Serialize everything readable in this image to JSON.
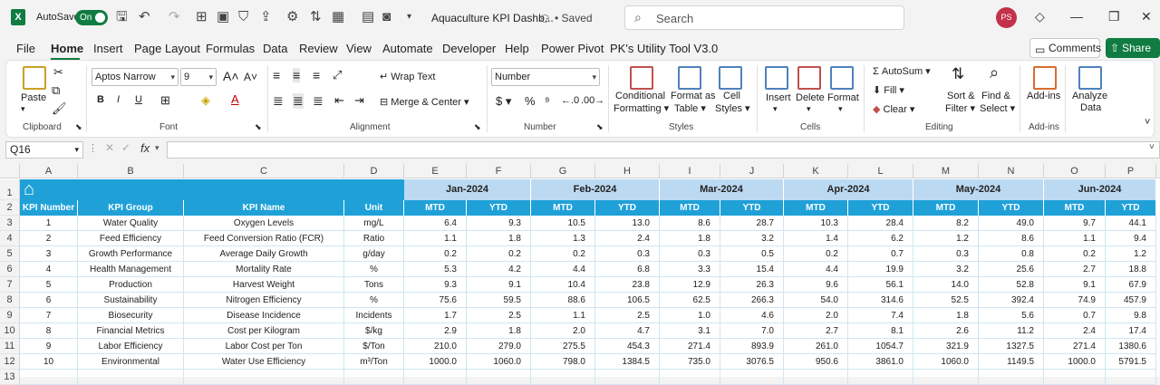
{
  "titlebar": {
    "autosave_label": "AutoSave",
    "autosave_state": "On",
    "doc_title": "Aquaculture KPI Dashb...",
    "saved_status": "• Saved",
    "search_placeholder": "Search",
    "user_initials": "PS"
  },
  "menu": {
    "items": [
      "File",
      "Home",
      "Insert",
      "Page Layout",
      "Formulas",
      "Data",
      "Review",
      "View",
      "Automate",
      "Developer",
      "Help",
      "Power Pivot",
      "PK's Utility Tool V3.0"
    ],
    "active": "Home",
    "comments_label": "Comments",
    "share_label": "Share"
  },
  "ribbon": {
    "clipboard": {
      "paste": "Paste",
      "label": "Clipboard"
    },
    "font": {
      "name": "Aptos Narrow",
      "size": "9",
      "label": "Font"
    },
    "alignment": {
      "wrap": "Wrap Text",
      "merge": "Merge & Center",
      "label": "Alignment"
    },
    "number": {
      "format": "Number",
      "label": "Number"
    },
    "styles": {
      "cond1": "Conditional",
      "cond2": "Formatting",
      "fmt1": "Format as",
      "fmt2": "Table",
      "cell1": "Cell",
      "cell2": "Styles",
      "label": "Styles"
    },
    "cells": {
      "insert": "Insert",
      "delete": "Delete",
      "format": "Format",
      "label": "Cells"
    },
    "editing": {
      "autosum": "AutoSum",
      "fill": "Fill",
      "clear": "Clear",
      "sort1": "Sort &",
      "sort2": "Filter",
      "find1": "Find &",
      "find2": "Select",
      "label": "Editing"
    },
    "addins": {
      "btn": "Add-ins",
      "label": "Add-ins"
    },
    "analyze": {
      "l1": "Analyze",
      "l2": "Data"
    }
  },
  "formula_bar": {
    "cell_ref": "Q16",
    "fx": "fx",
    "value": ""
  },
  "sheet": {
    "columns": [
      "A",
      "B",
      "C",
      "D",
      "E",
      "F",
      "G",
      "H",
      "I",
      "J",
      "K",
      "L",
      "M",
      "N",
      "O",
      "P"
    ],
    "rows": [
      "1",
      "2",
      "3",
      "4",
      "5",
      "6",
      "7",
      "8",
      "9",
      "10",
      "11",
      "12",
      "13"
    ],
    "months": [
      "Jan-2024",
      "Feb-2024",
      "Mar-2024",
      "Apr-2024",
      "May-2024",
      "Jun-2024"
    ],
    "headers": [
      "KPI Number",
      "KPI Group",
      "KPI Name",
      "Unit"
    ],
    "sub_headers": [
      "MTD",
      "YTD"
    ],
    "data": [
      [
        "1",
        "Water Quality",
        "Oxygen Levels",
        "mg/L",
        "6.4",
        "9.3",
        "10.5",
        "13.0",
        "8.6",
        "28.7",
        "10.3",
        "28.4",
        "8.2",
        "49.0",
        "9.7",
        "44.1"
      ],
      [
        "2",
        "Feed Efficiency",
        "Feed Conversion Ratio (FCR)",
        "Ratio",
        "1.1",
        "1.8",
        "1.3",
        "2.4",
        "1.8",
        "3.2",
        "1.4",
        "6.2",
        "1.2",
        "8.6",
        "1.1",
        "9.4"
      ],
      [
        "3",
        "Growth Performance",
        "Average Daily Growth",
        "g/day",
        "0.2",
        "0.2",
        "0.2",
        "0.3",
        "0.3",
        "0.5",
        "0.2",
        "0.7",
        "0.3",
        "0.8",
        "0.2",
        "1.2"
      ],
      [
        "4",
        "Health Management",
        "Mortality Rate",
        "%",
        "5.3",
        "4.2",
        "4.4",
        "6.8",
        "3.3",
        "15.4",
        "4.4",
        "19.9",
        "3.2",
        "25.6",
        "2.7",
        "18.8"
      ],
      [
        "5",
        "Production",
        "Harvest Weight",
        "Tons",
        "9.3",
        "9.1",
        "10.4",
        "23.8",
        "12.9",
        "26.3",
        "9.6",
        "56.1",
        "14.0",
        "52.8",
        "9.1",
        "67.9"
      ],
      [
        "6",
        "Sustainability",
        "Nitrogen Efficiency",
        "%",
        "75.6",
        "59.5",
        "88.6",
        "106.5",
        "62.5",
        "266.3",
        "54.0",
        "314.6",
        "52.5",
        "392.4",
        "74.9",
        "457.9"
      ],
      [
        "7",
        "Biosecurity",
        "Disease Incidence",
        "Incidents",
        "1.7",
        "2.5",
        "1.1",
        "2.5",
        "1.0",
        "4.6",
        "2.0",
        "7.4",
        "1.8",
        "5.6",
        "0.7",
        "9.8"
      ],
      [
        "8",
        "Financial Metrics",
        "Cost per Kilogram",
        "$/kg",
        "2.9",
        "1.8",
        "2.0",
        "4.7",
        "3.1",
        "7.0",
        "2.7",
        "8.1",
        "2.6",
        "11.2",
        "2.4",
        "17.4"
      ],
      [
        "9",
        "Labor Efficiency",
        "Labor Cost per Ton",
        "$/Ton",
        "210.0",
        "279.0",
        "275.5",
        "454.3",
        "271.4",
        "893.9",
        "261.0",
        "1054.7",
        "321.9",
        "1327.5",
        "271.4",
        "1380.6"
      ],
      [
        "10",
        "Environmental",
        "Water Use Efficiency",
        "m³/Ton",
        "1000.0",
        "1060.0",
        "798.0",
        "1384.5",
        "735.0",
        "3076.5",
        "950.6",
        "3861.0",
        "1060.0",
        "1149.5",
        "1000.0",
        "5791.5"
      ]
    ]
  }
}
